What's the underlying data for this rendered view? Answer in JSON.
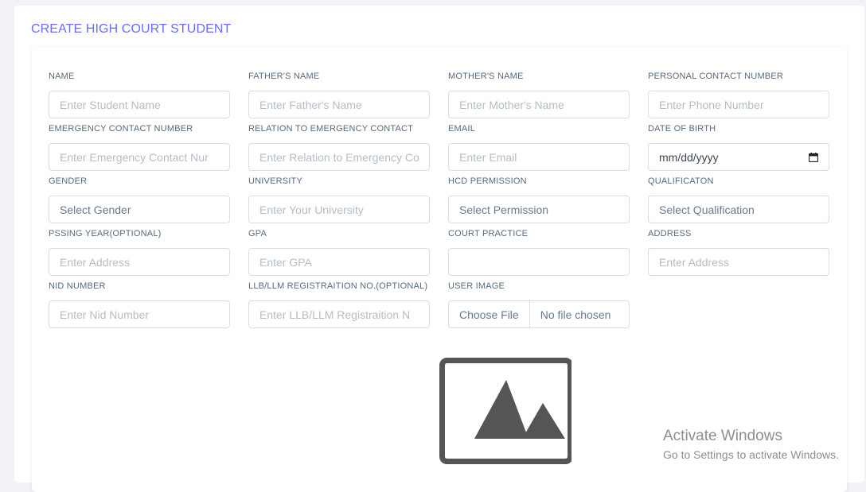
{
  "page": {
    "title": "CREATE HIGH COURT STUDENT"
  },
  "fields": {
    "name": {
      "label": "NAME",
      "placeholder": "Enter Student Name"
    },
    "father_name": {
      "label": "FATHER'S NAME",
      "placeholder": "Enter Father's Name"
    },
    "mother_name": {
      "label": "MOTHER'S NAME",
      "placeholder": "Enter Mother's Name"
    },
    "personal_contact": {
      "label": "PERSONAL CONTACT NUMBER",
      "placeholder": "Enter Phone Number"
    },
    "emergency_contact": {
      "label": "EMERGENCY CONTACT NUMBER",
      "placeholder": "Enter Emergency Contact Nur"
    },
    "relation_emergency": {
      "label": "RELATION TO EMERGENCY CONTACT",
      "placeholder": "Enter Relation to Emergency Co"
    },
    "email": {
      "label": "EMAIL",
      "placeholder": "Enter Email"
    },
    "dob": {
      "label": "DATE OF BIRTH",
      "value": "mm/dd/yyyy"
    },
    "gender": {
      "label": "GENDER",
      "value": "Select Gender"
    },
    "university": {
      "label": "UNIVERSITY",
      "placeholder": "Enter Your University"
    },
    "hcd_permission": {
      "label": "HCD PERMISSION",
      "value": "Select Permission"
    },
    "qualification": {
      "label": "QUALIFICATON",
      "value": "Select Qualification"
    },
    "passing_year": {
      "label": "PSSING YEAR(OPTIONAL)",
      "placeholder": "Enter Address"
    },
    "gpa": {
      "label": "GPA",
      "placeholder": "Enter GPA"
    },
    "court_practice": {
      "label": "COURT PRACTICE",
      "placeholder": ""
    },
    "address": {
      "label": "ADDRESS",
      "placeholder": "Enter Address"
    },
    "nid": {
      "label": "NID NUMBER",
      "placeholder": "Enter Nid Number"
    },
    "llb_reg": {
      "label": "LLB/LLM REGISTRAITION NO.(OPTIONAL)",
      "placeholder": "Enter LLB/LLM Registraition N"
    },
    "user_image": {
      "label": "USER IMAGE",
      "button": "Choose File",
      "status": "No file chosen"
    }
  },
  "preview": {
    "icon": "image-placeholder-icon"
  },
  "watermark": {
    "title": "Activate Windows",
    "subtitle": "Go to Settings to activate Windows."
  },
  "colors": {
    "accent": "#696cff",
    "label": "#566a7f",
    "border": "#d9dee3",
    "placeholder": "#b4bdc6"
  }
}
